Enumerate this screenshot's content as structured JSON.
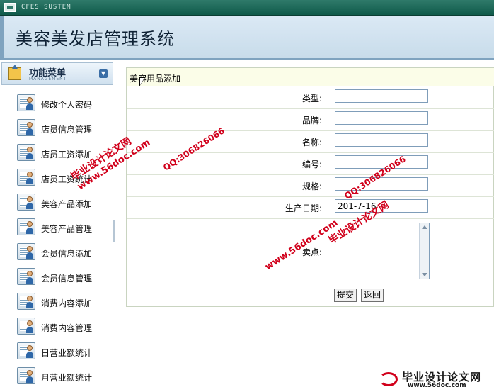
{
  "system_bar": {
    "label": "CFES SUSTEM"
  },
  "header": {
    "title": "美容美发店管理系统"
  },
  "sidebar": {
    "menu_title": "功能菜单",
    "menu_subtitle": "MANAGEMENT",
    "items": [
      {
        "label": "修改个人密码"
      },
      {
        "label": "店员信息管理"
      },
      {
        "label": "店员工资添加"
      },
      {
        "label": "店员工资统计"
      },
      {
        "label": "美容产品添加"
      },
      {
        "label": "美容产品管理"
      },
      {
        "label": "会员信息添加"
      },
      {
        "label": "会员信息管理"
      },
      {
        "label": "消费内容添加"
      },
      {
        "label": "消费内容管理"
      },
      {
        "label": "日营业额统计"
      },
      {
        "label": "月营业额统计"
      }
    ]
  },
  "form": {
    "title": "美容用品添加",
    "fields": {
      "type": {
        "label": "类型:",
        "value": ""
      },
      "brand": {
        "label": "品牌:",
        "value": ""
      },
      "name": {
        "label": "名称:",
        "value": ""
      },
      "code": {
        "label": "编号:",
        "value": ""
      },
      "spec": {
        "label": "规格:",
        "value": ""
      },
      "production_date": {
        "label": "生产日期:",
        "value": "201-7-16"
      },
      "selling_point": {
        "label": "卖点:",
        "value": ""
      }
    },
    "submit_label": "提交",
    "back_label": "返回"
  },
  "watermarks": {
    "brand": "毕业设计论文网",
    "site": "www.56doc.com",
    "qq": "QQ:306826066",
    "footer_brand": "毕业设计论文网",
    "footer_url": "www.56doc.com"
  },
  "colors": {
    "system_bar": "#0f5a4a",
    "header_bg": "#c8dcea",
    "panel_head_bg": "#fbfde8",
    "watermark": "#d1001b"
  }
}
